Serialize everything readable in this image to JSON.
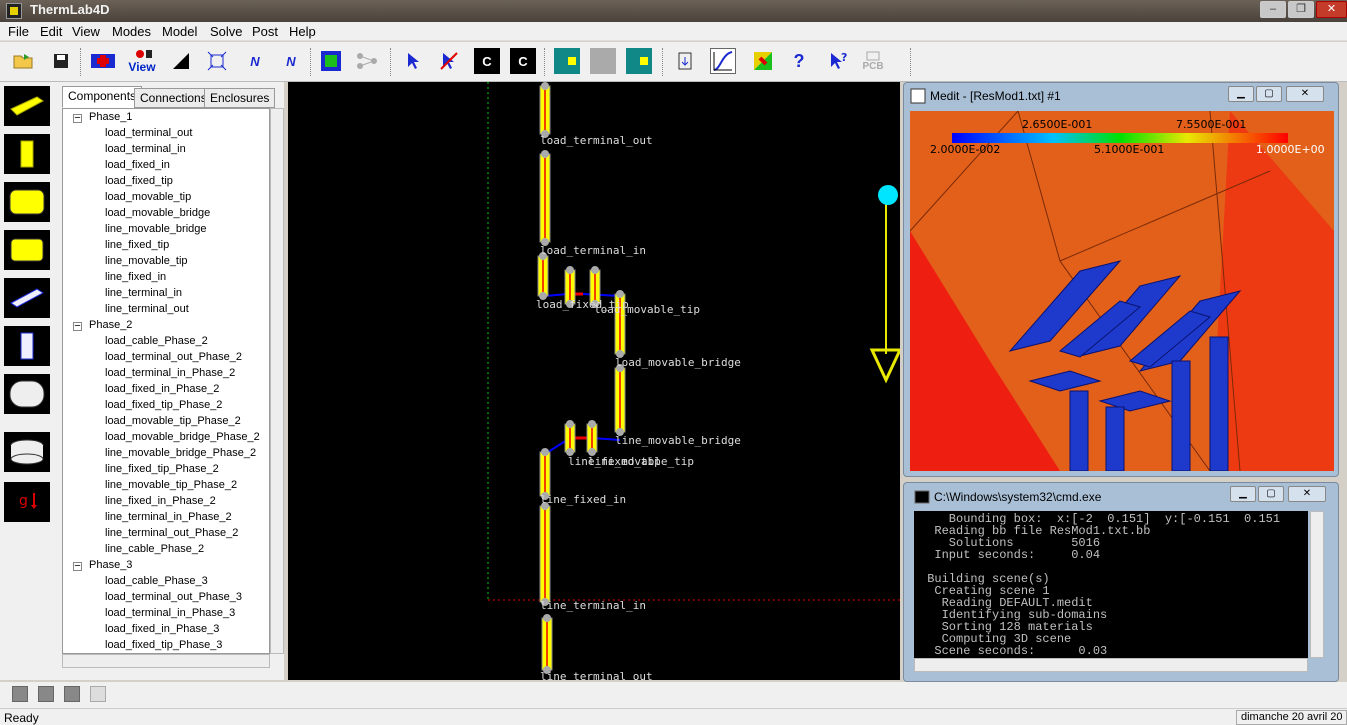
{
  "app": {
    "title": "ThermLab4D"
  },
  "menu": [
    "File",
    "Edit",
    "View",
    "Modes",
    "Model",
    "Solve",
    "Post",
    "Help"
  ],
  "toolbar": {
    "view_label": "View",
    "pcb_label": "PCB",
    "c_label": "C",
    "help_label": "?",
    "n_label": "N"
  },
  "tabs": [
    "Components",
    "Connections",
    "Enclosures"
  ],
  "tree": {
    "phase1": {
      "label": "Phase_1",
      "items": [
        "load_terminal_out",
        "load_terminal_in",
        "load_fixed_in",
        "load_fixed_tip",
        "load_movable_tip",
        "load_movable_bridge",
        "line_movable_bridge",
        "line_fixed_tip",
        "line_movable_tip",
        "line_fixed_in",
        "line_terminal_in",
        "line_terminal_out"
      ]
    },
    "phase2": {
      "label": "Phase_2",
      "items": [
        "load_cable_Phase_2",
        "load_terminal_out_Phase_2",
        "load_terminal_in_Phase_2",
        "load_fixed_in_Phase_2",
        "load_fixed_tip_Phase_2",
        "load_movable_tip_Phase_2",
        "load_movable_bridge_Phase_2",
        "line_movable_bridge_Phase_2",
        "line_fixed_tip_Phase_2",
        "line_movable_tip_Phase_2",
        "line_fixed_in_Phase_2",
        "line_terminal_in_Phase_2",
        "line_terminal_out_Phase_2",
        "line_cable_Phase_2"
      ]
    },
    "phase3": {
      "label": "Phase_3",
      "items": [
        "load_cable_Phase_3",
        "load_terminal_out_Phase_3",
        "load_terminal_in_Phase_3",
        "load_fixed_in_Phase_3",
        "load_fixed_tip_Phase_3"
      ]
    }
  },
  "canvas": {
    "labels": {
      "load_terminal_out": "load_terminal_out",
      "load_terminal_in": "load_terminal_in",
      "load_fixed_tip": "load_fixed_tip",
      "load_movable_tip": "load_movable_tip",
      "load_movable_bridge": "load_movable_bridge",
      "line_movable_bridge": "line_movable_bridge",
      "line_fixed_tip": "line_fixed_tip",
      "line_movable_tip": "line_movable_tip",
      "line_fixed_in": "line_fixed_in",
      "line_terminal_in": "line_terminal_in",
      "line_terminal_out": "line_terminal_out"
    }
  },
  "medit": {
    "title": "Medit - [ResMod1.txt] #1",
    "scale_top": [
      "2.6500E-001",
      "7.5500E-001"
    ],
    "scale_bottom": [
      "2.0000E-002",
      "5.1000E-001",
      "1.0000E+00"
    ]
  },
  "cmd": {
    "title": "C:\\Windows\\system32\\cmd.exe",
    "lines": [
      "    Bounding box:  x:[-2  0.151]  y:[-0.151  0.151",
      "  Reading bb file ResMod1.txt.bb",
      "    Solutions        5016",
      "  Input seconds:     0.04",
      "",
      " Building scene(s)",
      "  Creating scene 1",
      "   Reading DEFAULT.medit",
      "   Identifying sub-domains",
      "   Sorting 128 materials",
      "   Computing 3D scene",
      "  Scene seconds:      0.03"
    ]
  },
  "status": {
    "ready": "Ready",
    "date": "dimanche 20 avril 20"
  },
  "colors": {
    "yellow": "#ffff00",
    "red": "#ff0000",
    "blue": "#0000ff",
    "cyan": "#00e5ff",
    "green": "#00cc00",
    "orange": "#e2601a"
  }
}
